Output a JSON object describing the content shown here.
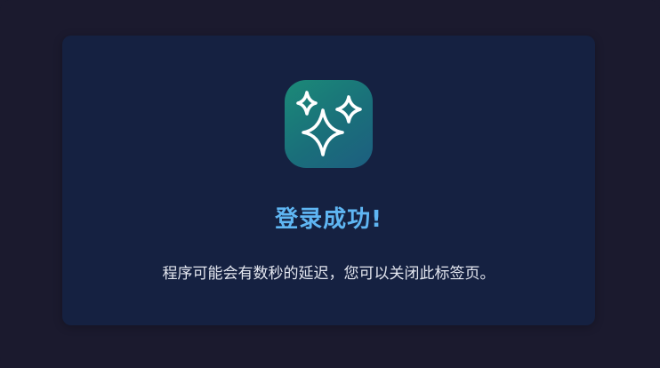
{
  "dialog": {
    "icon": "sparkles-icon",
    "title": "登录成功!",
    "message": "程序可能会有数秒的延迟，您可以关闭此标签页。"
  },
  "colors": {
    "background": "#1b1a2e",
    "card": "#152141",
    "title": "#5fb6f3",
    "message": "#e3e6ef",
    "icon_gradient_start": "#1b8a78",
    "icon_gradient_end": "#1d5e80"
  }
}
